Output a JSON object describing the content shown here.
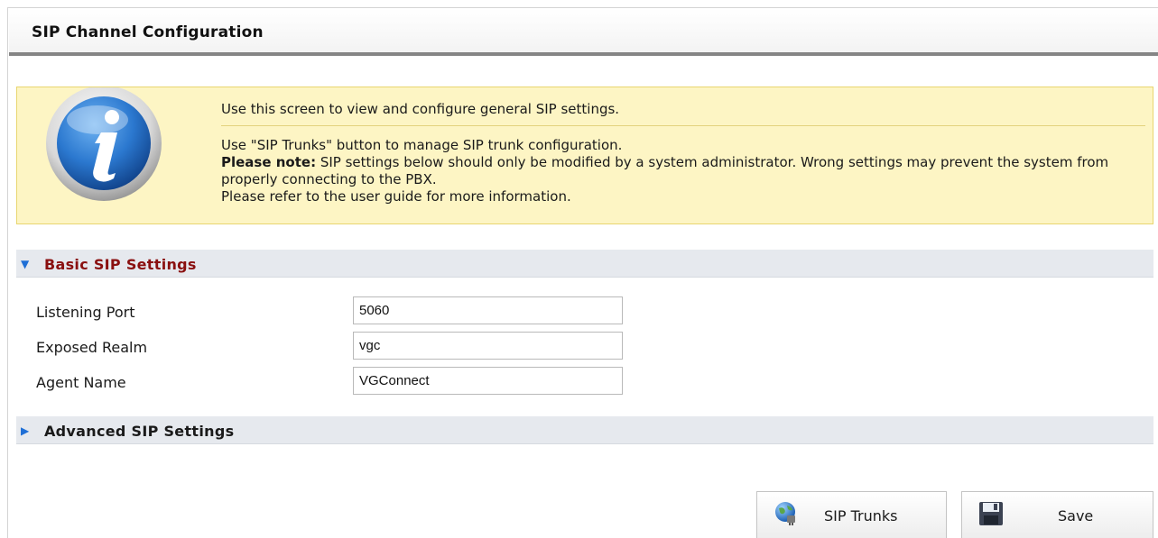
{
  "page": {
    "title": "SIP Channel Configuration"
  },
  "info": {
    "icon": "info-icon",
    "line1": "Use this screen to view and configure general SIP settings.",
    "line2": "Use \"SIP Trunks\" button to manage SIP trunk configuration.",
    "note_label": "Please note:",
    "note_text": " SIP settings below should only be modified by a system administrator. Wrong settings may prevent the system from properly connecting to the PBX.",
    "line4": "Please refer to the user guide for more information."
  },
  "basic_section": {
    "label": "Basic SIP Settings",
    "state": "expanded",
    "fields": [
      {
        "label": "Listening Port",
        "value": "5060"
      },
      {
        "label": "Exposed Realm",
        "value": "vgc"
      },
      {
        "label": "Agent Name",
        "value": "VGConnect"
      }
    ]
  },
  "advanced_section": {
    "label": "Advanced SIP Settings",
    "state": "collapsed"
  },
  "buttons": {
    "sip_trunks": {
      "label": "SIP Trunks",
      "icon": "globe-plug-icon"
    },
    "save": {
      "label": "Save",
      "icon": "floppy-disk-icon"
    }
  },
  "colors": {
    "info_background": "#fdf5c4",
    "section_header_bg": "#e6e9ee",
    "basic_section_label": "#8a1010",
    "expand_arrow": "#1f6fd6"
  }
}
